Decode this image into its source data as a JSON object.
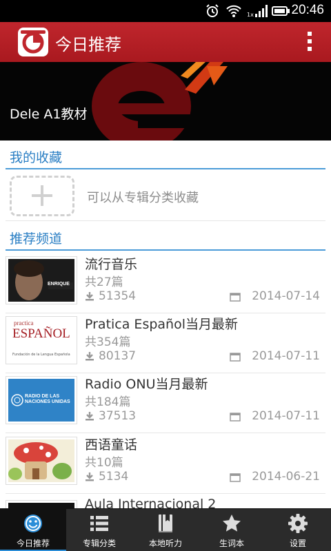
{
  "status_bar": {
    "time": "20:46"
  },
  "action_bar": {
    "title": "今日推荐"
  },
  "banner": {
    "caption": "Dele A1教材",
    "page_dots": 6,
    "active_dot": 1
  },
  "favorites": {
    "header": "我的收藏",
    "empty_hint": "可以从专辑分类收藏"
  },
  "recommended": {
    "header": "推荐频道",
    "items": [
      {
        "title": "流行音乐",
        "count": "共27篇",
        "downloads": "51354",
        "date": "2014-07-14",
        "thumb_text": "ENRIQUE"
      },
      {
        "title": "Pratica Español当月最新",
        "count": "共354篇",
        "downloads": "80137",
        "date": "2014-07-11",
        "thumb_text": "ESPAÑOL",
        "thumb_small_top": "practica",
        "thumb_small_bottom": "Fundación de la Lengua Española"
      },
      {
        "title": "Radio ONU当月最新",
        "count": "共184篇",
        "downloads": "37513",
        "date": "2014-07-11",
        "thumb_text": "RADIO DE LAS NACIONES UNIDAS"
      },
      {
        "title": "西语童话",
        "count": "共10篇",
        "downloads": "5134",
        "date": "2014-06-21"
      },
      {
        "title": "Aula Internacional 2"
      }
    ]
  },
  "tabs": [
    {
      "label": "今日推荐",
      "icon": "smiley-icon",
      "active": true
    },
    {
      "label": "专辑分类",
      "icon": "list-icon",
      "active": false
    },
    {
      "label": "本地听力",
      "icon": "book-icon",
      "active": false
    },
    {
      "label": "生词本",
      "icon": "star-icon",
      "active": false
    },
    {
      "label": "设置",
      "icon": "gear-icon",
      "active": false
    }
  ],
  "colors": {
    "accent_red": "#b81f27",
    "accent_blue": "#2b7fc4",
    "tab_bar": "#2b2b2b"
  }
}
